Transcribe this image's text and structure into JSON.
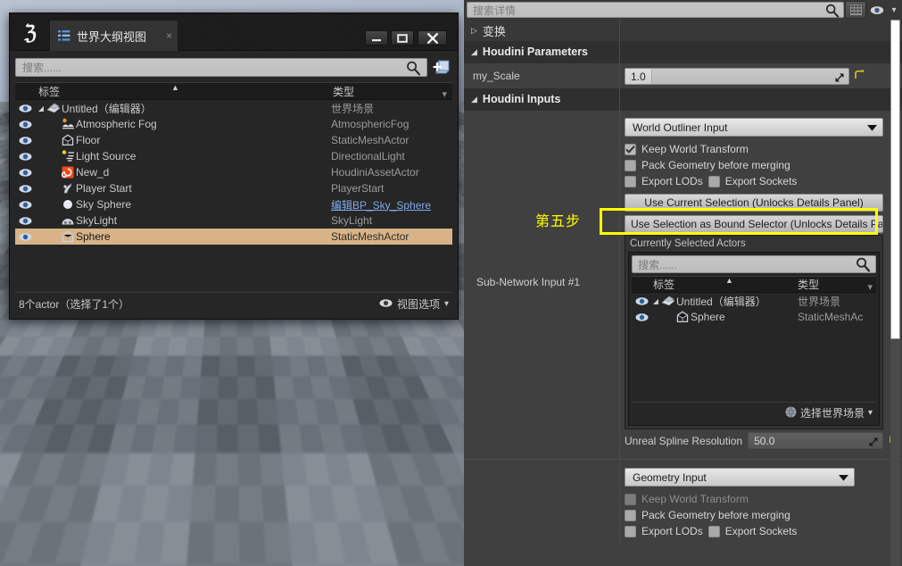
{
  "outliner_window": {
    "logo_glyph": "ℨ",
    "tab": {
      "label": "世界大纲视图",
      "close": "×"
    },
    "window_buttons": {
      "minimize": "minimize",
      "maximize": "maximize",
      "close": "close"
    },
    "search": {
      "placeholder": "搜索......"
    },
    "add_button_name": "add-actor-button",
    "columns": {
      "label": "标签",
      "type": "类型"
    },
    "rows": [
      {
        "label": "Untitled（编辑器）",
        "type": "世界场景",
        "indent": 0,
        "icon": "world-icon",
        "twisty": "◢",
        "selected": false,
        "link": false
      },
      {
        "label": "Atmospheric Fog",
        "type": "AtmosphericFog",
        "indent": 1,
        "icon": "fog-icon",
        "twisty": "",
        "selected": false,
        "link": false
      },
      {
        "label": "Floor",
        "type": "StaticMeshActor",
        "indent": 1,
        "icon": "mesh-icon",
        "twisty": "",
        "selected": false,
        "link": false
      },
      {
        "label": "Light Source",
        "type": "DirectionalLight",
        "indent": 1,
        "icon": "light-icon",
        "twisty": "",
        "selected": false,
        "link": false
      },
      {
        "label": "New_d",
        "type": "HoudiniAssetActor",
        "indent": 1,
        "icon": "houdini-icon",
        "twisty": "",
        "selected": false,
        "link": false
      },
      {
        "label": "Player Start",
        "type": "PlayerStart",
        "indent": 1,
        "icon": "player-start-icon",
        "twisty": "",
        "selected": false,
        "link": false
      },
      {
        "label": "Sky Sphere",
        "type": "编辑BP_Sky_Sphere",
        "indent": 1,
        "icon": "sphere-icon",
        "twisty": "",
        "selected": false,
        "link": true
      },
      {
        "label": "SkyLight",
        "type": "SkyLight",
        "indent": 1,
        "icon": "skylight-icon",
        "twisty": "",
        "selected": false,
        "link": false
      },
      {
        "label": "Sphere",
        "type": "StaticMeshActor",
        "indent": 1,
        "icon": "mesh-icon",
        "twisty": "",
        "selected": true,
        "link": false
      }
    ],
    "footer": {
      "count_text": "8个actor（选择了1个）",
      "view_options": "视图选项",
      "caret": "▾"
    }
  },
  "details_panel": {
    "search": {
      "placeholder": "搜索详情"
    },
    "top_buttons": {
      "grid": "grid-view-icon",
      "eye": "visibility-icon",
      "caret": "▾"
    },
    "categories": {
      "transform": {
        "label": "变换",
        "twisty": "▷",
        "expanded": false
      },
      "houdini_parameters": {
        "label": "Houdini Parameters",
        "twisty": "◢",
        "expanded": true
      },
      "houdini_inputs": {
        "label": "Houdini Inputs",
        "twisty": "◢",
        "expanded": true
      }
    },
    "my_scale": {
      "label": "my_Scale",
      "value": "1.0",
      "reset_icon": "reset-arrow-icon"
    },
    "input_1": {
      "type_value": "World Outliner Input",
      "keep_world_transform": {
        "label": "Keep World Transform",
        "checked": true
      },
      "pack_geometry": {
        "label": "Pack Geometry before merging",
        "checked": false
      },
      "export_lods": {
        "label": "Export LODs",
        "checked": false
      },
      "export_sockets": {
        "label": "Export Sockets",
        "checked": false
      },
      "use_current_selection": "Use Current Selection (Unlocks Details Panel)",
      "use_bound_selector": "Use Selection as Bound Selector (Unlocks Details Pa",
      "left_label": "Sub-Network Input #1",
      "currently_selected_actors": {
        "title": "Currently Selected Actors",
        "search_placeholder": "搜索......",
        "columns": {
          "label": "标签",
          "type": "类型"
        },
        "rows": [
          {
            "label": "Untitled（编辑器）",
            "type": "世界场景",
            "indent": 0,
            "icon": "world-icon",
            "twisty": "◢"
          },
          {
            "label": "Sphere",
            "type": "StaticMeshAc",
            "indent": 1,
            "icon": "mesh-icon",
            "twisty": ""
          }
        ],
        "footer": {
          "label": "选择世界场景",
          "caret": "▾",
          "icon": "globe-icon"
        }
      },
      "spline_resolution": {
        "label": "Unreal Spline Resolution",
        "value": "50.0",
        "reset_icon": "reset-arrow-icon"
      }
    },
    "input_2": {
      "type_value": "Geometry Input",
      "keep_world_transform": {
        "label": "Keep World Transform",
        "checked": false,
        "disabled": true
      },
      "pack_geometry": {
        "label": "Pack Geometry before merging",
        "checked": false
      },
      "export_lods": {
        "label": "Export LODs",
        "checked": false
      },
      "export_sockets": {
        "label": "Export Sockets",
        "checked": false
      }
    },
    "scrollbar_name": "details-vertical-scrollbar"
  },
  "annotation": {
    "step_text": "第五步",
    "color": "#ffff00"
  },
  "viewport": {
    "selected_actor": "Sphere",
    "gizmo": {
      "x_color": "#e24a1c",
      "y_color": "#6fae1e",
      "z_color": "#3a8fe0"
    },
    "selection_outline_color": "#f0a830"
  }
}
